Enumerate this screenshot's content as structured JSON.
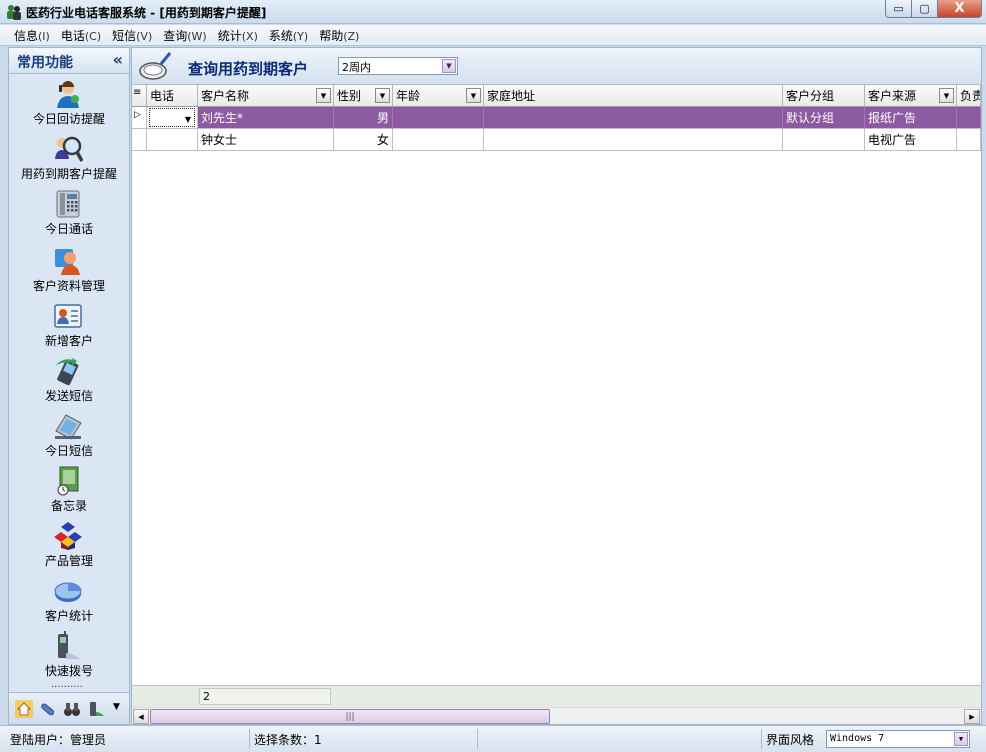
{
  "window": {
    "title": "医药行业电话客服系统 - [用药到期客户提醒]",
    "min_label": "▭",
    "max_label": "▢",
    "close_label": "X"
  },
  "menu": [
    {
      "label": "信息",
      "acc": "(I)"
    },
    {
      "label": "电话",
      "acc": "(C)"
    },
    {
      "label": "短信",
      "acc": "(V)"
    },
    {
      "label": "查询",
      "acc": "(W)"
    },
    {
      "label": "统计",
      "acc": "(X)"
    },
    {
      "label": "系统",
      "acc": "(Y)"
    },
    {
      "label": "帮助",
      "acc": "(Z)"
    }
  ],
  "sidebar": {
    "title": "常用功能",
    "collapse": "«",
    "items": [
      {
        "label": "今日回访提醒",
        "icon": "callback-agent-icon"
      },
      {
        "label": "用药到期客户提醒",
        "icon": "search-users-icon"
      },
      {
        "label": "今日通话",
        "icon": "telephone-icon"
      },
      {
        "label": "客户资料管理",
        "icon": "customer-profile-icon"
      },
      {
        "label": "新增客户",
        "icon": "contact-card-icon"
      },
      {
        "label": "发送短信",
        "icon": "send-sms-icon"
      },
      {
        "label": "今日短信",
        "icon": "sms-inbox-icon"
      },
      {
        "label": "备忘录",
        "icon": "memo-icon"
      },
      {
        "label": "产品管理",
        "icon": "product-cubes-icon"
      },
      {
        "label": "客户统计",
        "icon": "pie-chart-icon"
      },
      {
        "label": "快速拨号",
        "icon": "mobile-phone-icon"
      }
    ],
    "dots": "··········"
  },
  "toolbar": {
    "title": "查询用药到期客户",
    "period_value": "2周内"
  },
  "grid": {
    "columns": [
      "电话",
      "客户名称",
      "性别",
      "年龄",
      "家庭地址",
      "客户分组",
      "客户来源",
      "负责"
    ],
    "rows": [
      {
        "phone": "",
        "name": "刘先生*",
        "gender": "男",
        "age": "",
        "address": "",
        "group": "默认分组",
        "source": "报纸广告",
        "owner": ""
      },
      {
        "phone": "",
        "name": "钟女士",
        "gender": "女",
        "age": "",
        "address": "",
        "group": "",
        "source": "电视广告",
        "owner": ""
      }
    ],
    "footer_count": "2"
  },
  "status": {
    "user": "登陆用户：管理员",
    "selected": "选择条数：1",
    "style_label": "界面风格",
    "style_value": "Windows 7"
  },
  "colors": {
    "selected_row": "#8c5aa0",
    "title_blue": "#0b2a78"
  }
}
